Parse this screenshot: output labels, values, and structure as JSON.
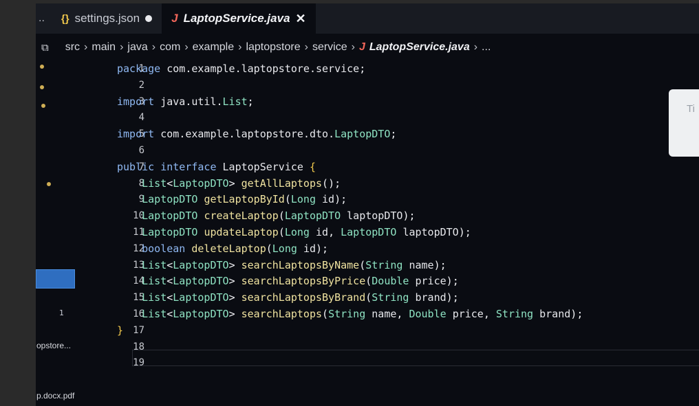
{
  "tabs": [
    {
      "icon": "{}",
      "label": "settings.json",
      "state": "modified"
    },
    {
      "icon": "J",
      "label": "LaptopService.java",
      "state": "active"
    }
  ],
  "tab_overflow": "..",
  "close_glyph": "✕",
  "breadcrumb": {
    "segments": [
      "src",
      "main",
      "java",
      "com",
      "example",
      "laptopstore",
      "service"
    ],
    "file_icon": "J",
    "file": "LaptopService.java",
    "more": "..."
  },
  "line_numbers": [
    "1",
    "2",
    "3",
    "4",
    "5",
    "6",
    "7",
    "8",
    "9",
    "10",
    "11",
    "12",
    "13",
    "14",
    "15",
    "16",
    "17",
    "18",
    "19"
  ],
  "code_lines": [
    "package com.example.laptopstore.service;",
    "",
    "import java.util.List;",
    "",
    "import com.example.laptopstore.dto.LaptopDTO;",
    "",
    "public interface LaptopService {",
    "    List<LaptopDTO> getAllLaptops();",
    "    LaptopDTO getLaptopById(Long id);",
    "    LaptopDTO createLaptop(LaptopDTO laptopDTO);",
    "    LaptopDTO updateLaptop(Long id, LaptopDTO laptopDTO);",
    "    boolean deleteLaptop(Long id);",
    "    List<LaptopDTO> searchLaptopsByName(String name);",
    "    List<LaptopDTO> searchLaptopsByPrice(Double price);",
    "    List<LaptopDTO> searchLaptopsByBrand(String brand);",
    "    List<LaptopDTO> searchLaptops(String name, Double price, String brand);",
    "}",
    "",
    ""
  ],
  "sidebar": {
    "badge": "1",
    "item_opstore": "opstore...",
    "item_docx": "p.docx.pdf"
  },
  "hover_card_text": "Ti",
  "colors": {
    "keyword": "#8fb8f2",
    "type": "#8fe3c3",
    "method": "#f0e3a0",
    "brace": "#f2c94c",
    "java_icon": "#f2665a",
    "json_icon": "#f2c94c"
  }
}
